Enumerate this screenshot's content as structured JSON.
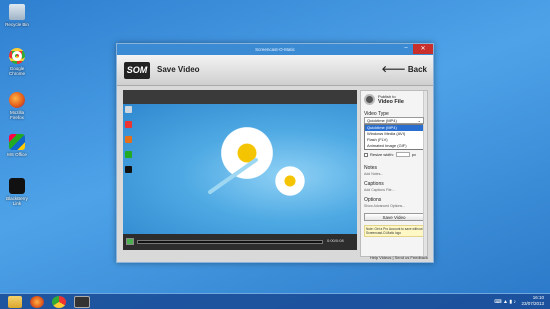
{
  "desktop": {
    "icons": [
      {
        "label": "Recycle Bin",
        "icon": "recycle-bin-icon"
      },
      {
        "label": "Google Chrome",
        "icon": "chrome-icon"
      },
      {
        "label": "Mozilla Firefox",
        "icon": "firefox-icon"
      },
      {
        "label": "MS Office",
        "icon": "office-icon"
      },
      {
        "label": "BlackBerry Link",
        "icon": "blackberry-icon"
      }
    ]
  },
  "window": {
    "title": "Screencast-O-Matic",
    "close_label": "✕",
    "min_label": "–"
  },
  "header": {
    "logo": "SOM",
    "title": "Save Video",
    "back_label": "Back"
  },
  "player": {
    "time": "0:00/0:08"
  },
  "panel": {
    "publish_line1": "Publish to",
    "publish_line2": "Video File",
    "video_type_label": "Video Type",
    "selected_type": "Quicktime (MP4)",
    "type_options": [
      "Quicktime (MP4)",
      "Windows Media (AVI)",
      "Flash (FLV)",
      "Animated Image (GIF)"
    ],
    "resize_label": "Resize width:",
    "resize_unit": "px",
    "notes_label": "Notes",
    "notes_link": "Add Notes...",
    "captions_label": "Captions",
    "captions_link": "Add Captions File...",
    "options_label": "Options",
    "options_link": "Show Advanced Options...",
    "save_button": "Save Video",
    "note_text": "Note: Get a Pro Account to save without Screencast-O-Matic logo"
  },
  "footer": {
    "help": "Help Videos",
    "separator": "|",
    "feedback": "Send us Feedback"
  },
  "taskbar": {
    "time": "16:10",
    "date": "23/07/2013"
  }
}
